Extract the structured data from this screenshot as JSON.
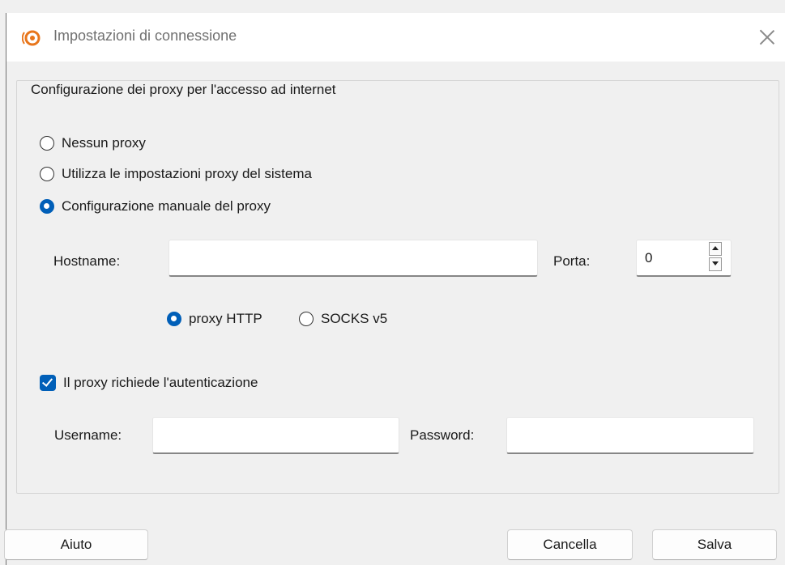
{
  "window": {
    "title": "Impostazioni di connessione"
  },
  "group": {
    "legend": "Configurazione dei proxy per l'accesso ad internet"
  },
  "proxy_modes": [
    {
      "label": "Nessun proxy",
      "selected": false
    },
    {
      "label": "Utilizza le impostazioni proxy del sistema",
      "selected": false
    },
    {
      "label": "Configurazione manuale del proxy",
      "selected": true
    }
  ],
  "manual": {
    "hostname_label": "Hostname:",
    "hostname_value": "",
    "port_label": "Porta:",
    "port_value": "0"
  },
  "proxy_types": [
    {
      "label": "proxy HTTP",
      "selected": true
    },
    {
      "label": "SOCKS v5",
      "selected": false
    }
  ],
  "auth": {
    "checkbox_label": "Il proxy richiede l'autenticazione",
    "checked": true,
    "username_label": "Username:",
    "username_value": "",
    "password_label": "Password:",
    "password_value": ""
  },
  "buttons": {
    "help": "Aiuto",
    "cancel": "Cancella",
    "save": "Salva"
  },
  "colors": {
    "accent": "#005fb8",
    "brand_icon": "#e8761c"
  }
}
